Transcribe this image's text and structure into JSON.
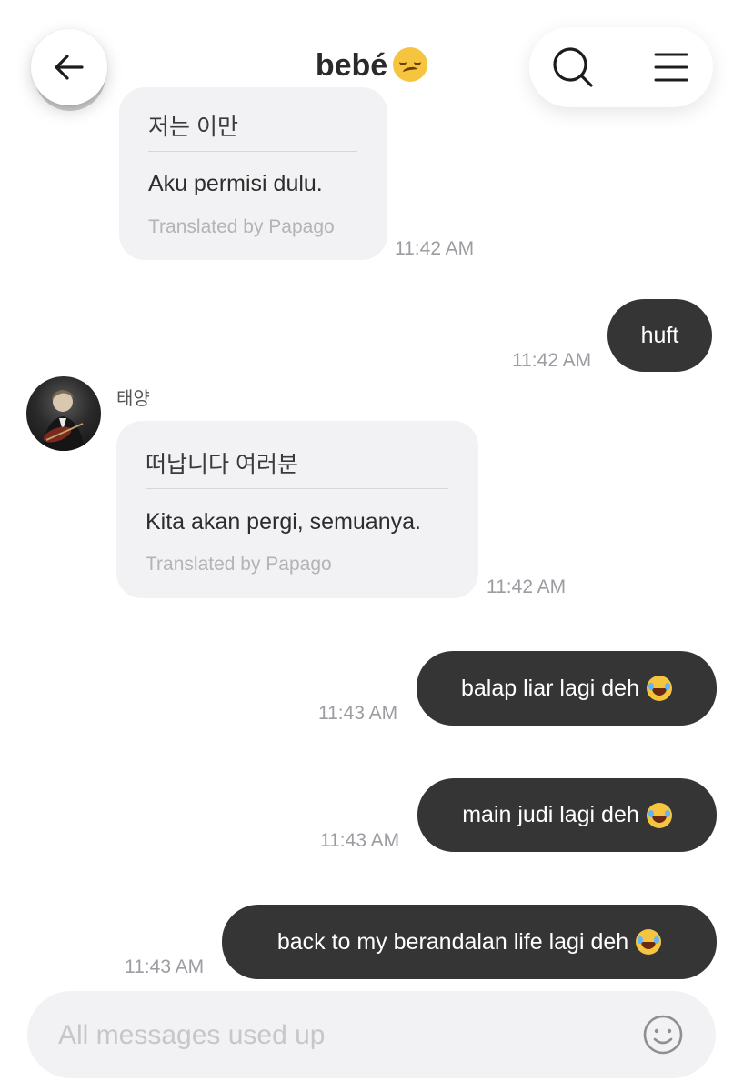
{
  "header": {
    "title": "bebé",
    "title_emoji": "woozy-face"
  },
  "messages": [
    {
      "direction": "in",
      "original": "저는 이만",
      "translation": "Aku permisi dulu.",
      "credit": "Translated by Papago",
      "time": "11:42 AM"
    },
    {
      "direction": "out",
      "text": "huft",
      "time": "11:42 AM"
    },
    {
      "direction": "in",
      "sender": "태양",
      "original": "떠납니다 여러분",
      "translation": "Kita akan pergi, semuanya.",
      "credit": "Translated by Papago",
      "time": "11:42 AM"
    },
    {
      "direction": "out",
      "text": "balap liar lagi deh",
      "emoji": "tears-of-joy",
      "time": "11:43 AM"
    },
    {
      "direction": "out",
      "text": "main judi lagi deh",
      "emoji": "tears-of-joy",
      "time": "11:43 AM"
    },
    {
      "direction": "out",
      "text": "back to my berandalan life lagi deh",
      "emoji": "tears-of-joy",
      "time": "11:43 AM"
    }
  ],
  "composer": {
    "placeholder": "All messages used up"
  },
  "colors": {
    "outgoing_bubble": "#353535",
    "incoming_bubble": "#f2f2f4",
    "timestamp": "#9c9ca1"
  }
}
